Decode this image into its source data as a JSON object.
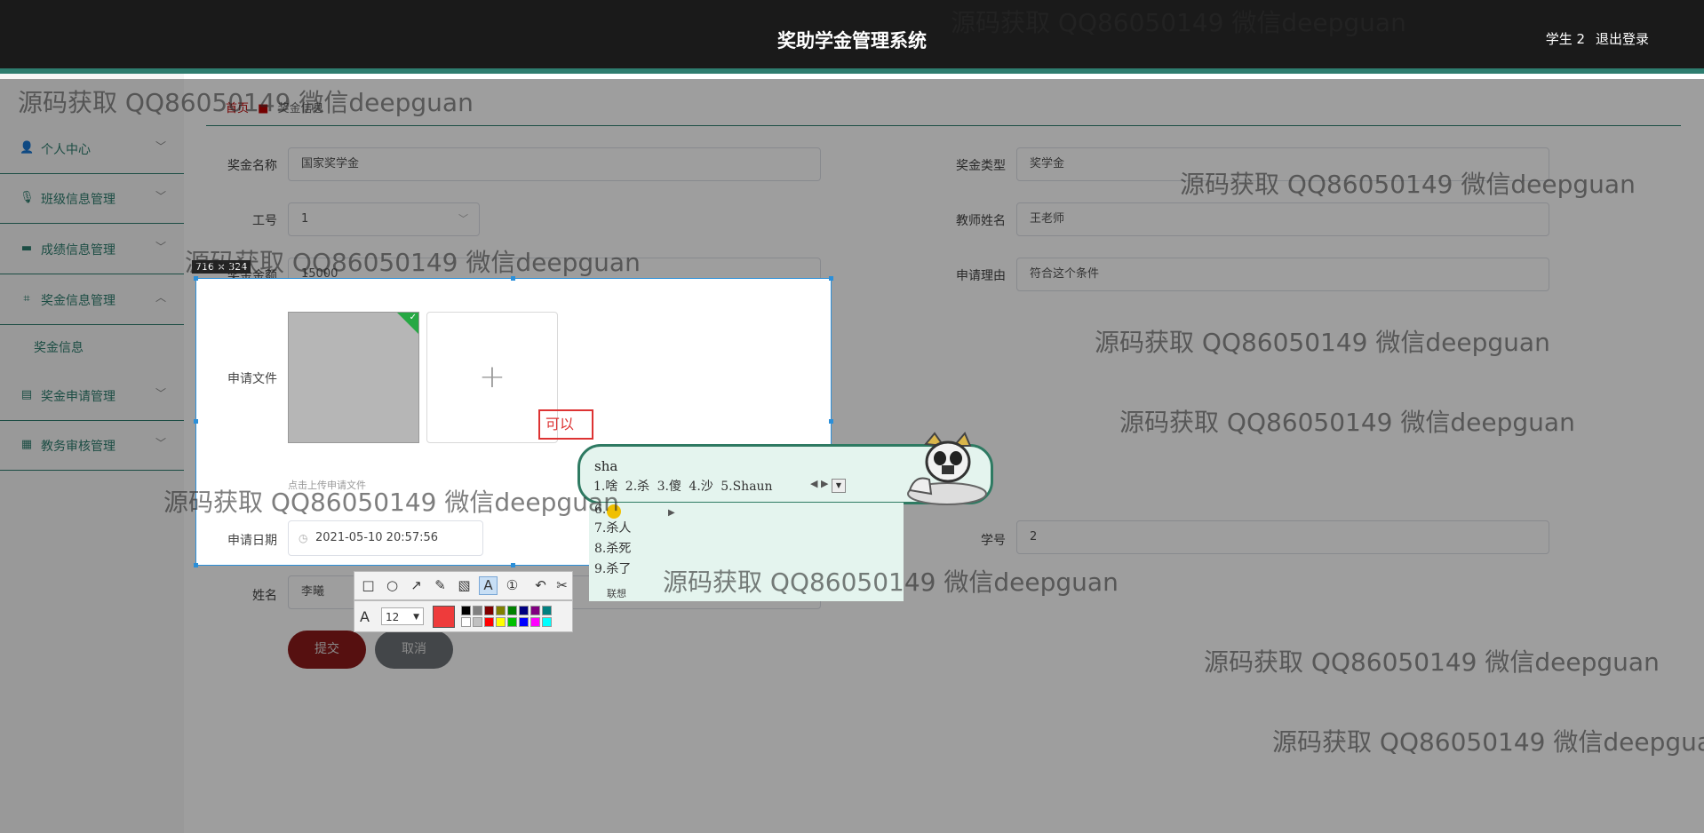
{
  "header": {
    "title": "奖助学金管理系统",
    "user": "学生 2",
    "logout": "退出登录"
  },
  "sidebar": {
    "items": [
      {
        "label": "个人中心",
        "icon": "user-icon",
        "glyph": "👤",
        "chevron": "﹀"
      },
      {
        "label": "班级信息管理",
        "icon": "mic-icon",
        "glyph": "🎙",
        "chevron": "﹀"
      },
      {
        "label": "成绩信息管理",
        "icon": "monitor-icon",
        "glyph": "▬",
        "chevron": "﹀"
      },
      {
        "label": "奖金信息管理",
        "icon": "crop-icon",
        "glyph": "⌗",
        "chevron": "︿"
      },
      {
        "label": "奖金申请管理",
        "icon": "briefcase-icon",
        "glyph": "▤",
        "chevron": "﹀"
      },
      {
        "label": "教务审核管理",
        "icon": "grid-icon",
        "glyph": "▦",
        "chevron": "﹀"
      }
    ],
    "subitem": "奖金信息"
  },
  "breadcrumb": {
    "first": "首页",
    "second": "奖金信息"
  },
  "form": {
    "award_name": {
      "label": "奖金名称",
      "value": "国家奖学金"
    },
    "award_type": {
      "label": "奖金类型",
      "value": "奖学金"
    },
    "staff_id": {
      "label": "工号",
      "value": "1"
    },
    "teacher_name": {
      "label": "教师姓名",
      "value": "王老师"
    },
    "amount": {
      "label": "奖金金额",
      "value": "15000"
    },
    "reason": {
      "label": "申请理由",
      "value": "符合这个条件"
    },
    "file": {
      "label": "申请文件",
      "hint": "点击上传申请文件"
    },
    "date": {
      "label": "申请日期",
      "value": "2021-05-10 20:57:56"
    },
    "student_no": {
      "label": "学号",
      "value": "2"
    },
    "name": {
      "label": "姓名",
      "value": "李曦"
    },
    "submit": "提交",
    "cancel": "取消"
  },
  "screenshot_tool": {
    "size_label": "716 × 324",
    "annotation_text": "可以",
    "font_size": "12",
    "current_color": "#ee3b3b",
    "palette": [
      "#000000",
      "#808080",
      "#800000",
      "#808000",
      "#008000",
      "#000080",
      "#800080",
      "#008080",
      "#ffffff",
      "#c0c0c0",
      "#ff0000",
      "#ffff00",
      "#00c000",
      "#0000ff",
      "#ff00ff",
      "#00ffff"
    ]
  },
  "ime": {
    "composition": "sha",
    "candidates": "1.啥 2.杀 3.傻 4.沙 5.Shaun",
    "nav": "◀ ▶",
    "list": [
      "6.",
      "7.杀人",
      "8.杀死",
      "9.杀了"
    ],
    "footer": "联想"
  },
  "watermark": "源码获取 QQ86050149 微信deepguan"
}
